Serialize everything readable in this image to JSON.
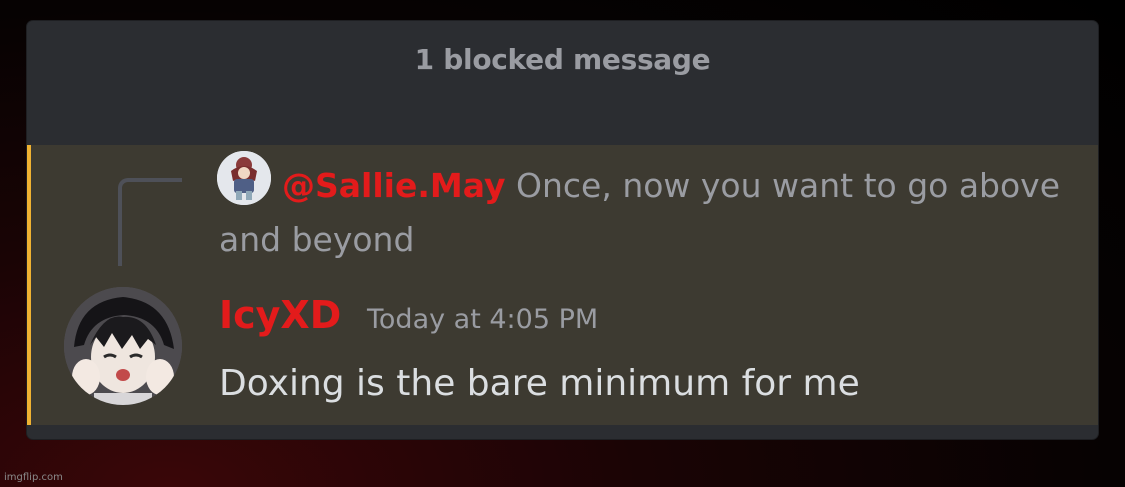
{
  "blocked": {
    "text": "1 blocked message"
  },
  "reply": {
    "mention": "@Sallie.May",
    "text": "Once, now you want to go above and beyond"
  },
  "message": {
    "author": "IcyXD",
    "timestamp": "Today at 4:05 PM",
    "content": "Doxing is the bare minimum for me"
  },
  "colors": {
    "mention": "#e31b1b",
    "highlight_bar": "#f0b232",
    "highlight_bg": "#3d3a31",
    "panel_bg": "#2b2d31"
  },
  "watermark": "imgflip.com"
}
